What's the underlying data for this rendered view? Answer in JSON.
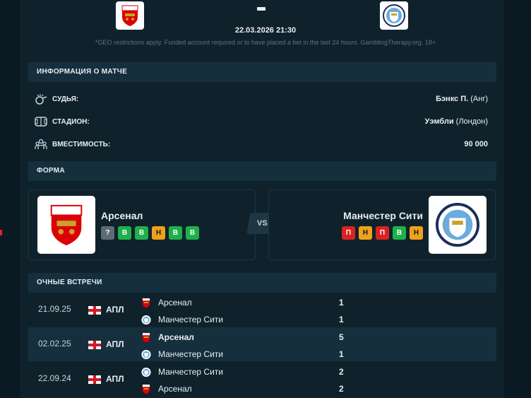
{
  "match": {
    "date_time": "22.03.2026 21:30",
    "disclaimer": "*GEO restrictions apply. Funded account required or to have placed a bet in the last 24 hours. GamblingTherapy.org. 18+"
  },
  "info": {
    "title": "ИНФОРМАЦИЯ О МАТЧЕ",
    "rows": [
      {
        "label": "СУДЬЯ:",
        "value": "Бэнкс П.",
        "sub": " (Анг)",
        "icon": "whistle-icon"
      },
      {
        "label": "СТАДИОН:",
        "value": "Уэмбли",
        "sub": " (Лондон)",
        "icon": "stadium-icon"
      },
      {
        "label": "ВМЕСТИМОСТЬ:",
        "value": "90 000",
        "sub": "",
        "icon": "crowd-icon"
      }
    ]
  },
  "form": {
    "title": "ФОРМА",
    "vs_label": "VS",
    "home": {
      "name": "Арсенал",
      "results": [
        "?",
        "В",
        "В",
        "Н",
        "В",
        "В"
      ],
      "types": [
        "u",
        "w",
        "w",
        "d",
        "w",
        "w"
      ]
    },
    "away": {
      "name": "Манчестер Сити",
      "results": [
        "П",
        "Н",
        "П",
        "В",
        "Н"
      ],
      "types": [
        "l",
        "d",
        "l",
        "w",
        "d"
      ]
    }
  },
  "h2h": {
    "title": "ОЧНЫЕ ВСТРЕЧИ",
    "matches": [
      {
        "date": "21.09.25",
        "league": "АПЛ",
        "team1": "Арсенал",
        "team2": "Манчестер Сити",
        "score1": "1",
        "score2": "1",
        "logo1": "arsenal",
        "logo2": "city",
        "winner": 0
      },
      {
        "date": "02.02.25",
        "league": "АПЛ",
        "team1": "Арсенал",
        "team2": "Манчестер Сити",
        "score1": "5",
        "score2": "1",
        "logo1": "arsenal",
        "logo2": "city",
        "winner": 1
      },
      {
        "date": "22.09.24",
        "league": "АПЛ",
        "team1": "Манчестер Сити",
        "team2": "Арсенал",
        "score1": "2",
        "score2": "2",
        "logo1": "city",
        "logo2": "arsenal",
        "winner": 0
      }
    ]
  },
  "colors": {
    "win": "#20b04b",
    "draw": "#f0a11a",
    "loss": "#d9231f",
    "unknown": "#5e6b73",
    "arsenal_red": "#db0007",
    "city_blue": "#6cabdd"
  }
}
